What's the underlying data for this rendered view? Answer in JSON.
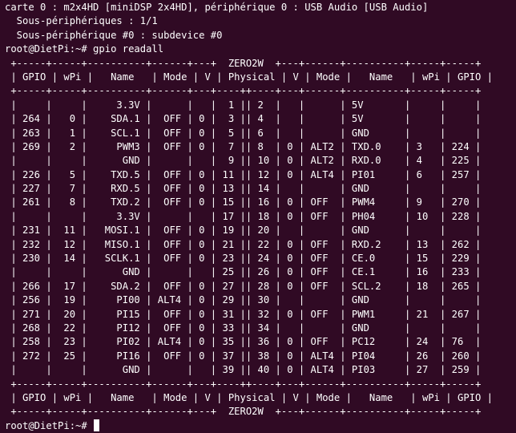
{
  "terminal": {
    "lines": [
      "carte 0 : m2x4HD [miniDSP 2x4HD], périphérique 0 : USB Audio [USB Audio]",
      "  Sous-périphériques : 1/1",
      "  Sous-périphérique #0 : subdevice #0",
      "root@DietPi:~# gpio readall",
      " +-----+-----+----------+------+---+  ZERO2W  +---+------+----------+-----+-----+",
      " | GPIO | wPi |   Name   | Mode | V | Physical | V | Mode |   Name   | wPi | GPIO |",
      " +-----+-----+----------+------+---+----++----+---+------+----------+-----+-----+",
      " |     |     |     3.3V |      |   |  1 || 2  |   |      | 5V       |     |     |",
      " | 264 |   0 |    SDA.1 |  OFF | 0 |  3 || 4  |   |      | 5V       |     |     |",
      " | 263 |   1 |    SCL.1 |  OFF | 0 |  5 || 6  |   |      | GND      |     |     |",
      " | 269 |   2 |     PWM3 |  OFF | 0 |  7 || 8  | 0 | ALT2 | TXD.0    | 3   | 224 |",
      " |     |     |      GND |      |   |  9 || 10 | 0 | ALT2 | RXD.0    | 4   | 225 |",
      " | 226 |   5 |    TXD.5 |  OFF | 0 | 11 || 12 | 0 | ALT4 | PI01     | 6   | 257 |",
      " | 227 |   7 |    RXD.5 |  OFF | 0 | 13 || 14 |   |      | GND      |     |     |",
      " | 261 |   8 |    TXD.2 |  OFF | 0 | 15 || 16 | 0 | OFF  | PWM4     | 9   | 270 |",
      " |     |     |     3.3V |      |   | 17 || 18 | 0 | OFF  | PH04     | 10  | 228 |",
      " | 231 |  11 |   MOSI.1 |  OFF | 0 | 19 || 20 |   |      | GND      |     |     |",
      " | 232 |  12 |   MISO.1 |  OFF | 0 | 21 || 22 | 0 | OFF  | RXD.2    | 13  | 262 |",
      " | 230 |  14 |   SCLK.1 |  OFF | 0 | 23 || 24 | 0 | OFF  | CE.0     | 15  | 229 |",
      " |     |     |      GND |      |   | 25 || 26 | 0 | OFF  | CE.1     | 16  | 233 |",
      " | 266 |  17 |    SDA.2 |  OFF | 0 | 27 || 28 | 0 | OFF  | SCL.2    | 18  | 265 |",
      " | 256 |  19 |     PI00 | ALT4 | 0 | 29 || 30 |   |      | GND      |     |     |",
      " | 271 |  20 |     PI15 |  OFF | 0 | 31 || 32 | 0 | OFF  | PWM1     | 21  | 267 |",
      " | 268 |  22 |     PI12 |  OFF | 0 | 33 || 34 |   |      | GND      |     |     |",
      " | 258 |  23 |     PI02 | ALT4 | 0 | 35 || 36 | 0 | OFF  | PC12     | 24  | 76  |",
      " | 272 |  25 |     PI16 |  OFF | 0 | 37 || 38 | 0 | ALT4 | PI04     | 26  | 260 |",
      " |     |     |      GND |      |   | 39 || 40 | 0 | ALT4 | PI03     | 27  | 259 |",
      " +-----+-----+----------+------+---+----++----+---+------+----------+-----+-----+",
      " | GPIO | wPi |   Name   | Mode | V | Physical | V | Mode |   Name   | wPi | GPIO |",
      " +-----+-----+----------+------+---+  ZERO2W  +---+------+----------+-----+-----+"
    ],
    "prompt": "root@DietPi:~# ",
    "colors": {
      "background": "#300a24",
      "foreground": "#ffffff",
      "cursor": "#ffffff"
    }
  }
}
